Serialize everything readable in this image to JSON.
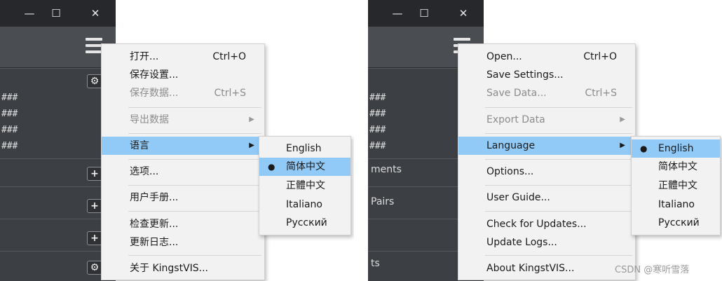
{
  "window_controls": {
    "minimize": "—",
    "maximize": "☐",
    "close": "✕"
  },
  "hash_rows": [
    "###",
    "###",
    "###",
    "###"
  ],
  "cn": {
    "menu": {
      "open": "打开...",
      "open_shortcut": "Ctrl+O",
      "save_settings": "保存设置...",
      "save_data": "保存数据...",
      "save_data_shortcut": "Ctrl+S",
      "export_data": "导出数据",
      "language": "语言",
      "options": "选项...",
      "user_guide": "用户手册...",
      "check_updates": "检查更新...",
      "update_logs": "更新日志...",
      "about": "关于 KingstVIS..."
    },
    "languages": [
      "English",
      "简体中文",
      "正體中文",
      "Italiano",
      "Русский"
    ],
    "selected_language": "简体中文"
  },
  "en": {
    "sidebar_labels": [
      "ments",
      "Pairs",
      "ts"
    ],
    "menu": {
      "open": "Open...",
      "open_shortcut": "Ctrl+O",
      "save_settings": "Save Settings...",
      "save_data": "Save Data...",
      "save_data_shortcut": "Ctrl+S",
      "export_data": "Export Data",
      "language": "Language",
      "options": "Options...",
      "user_guide": "User Guide...",
      "check_updates": "Check for Updates...",
      "update_logs": "Update Logs...",
      "about": "About KingstVIS..."
    },
    "languages": [
      "English",
      "简体中文",
      "正體中文",
      "Italiano",
      "Русский"
    ],
    "selected_language": "English"
  },
  "watermark": "CSDN @寒听雪落",
  "colors": {
    "highlight": "#91c9f7",
    "app_dark": "#3c3f44",
    "titlebar": "#26282b",
    "menu_bg": "#f2f2f2",
    "disabled_text": "#8c8c8c"
  }
}
